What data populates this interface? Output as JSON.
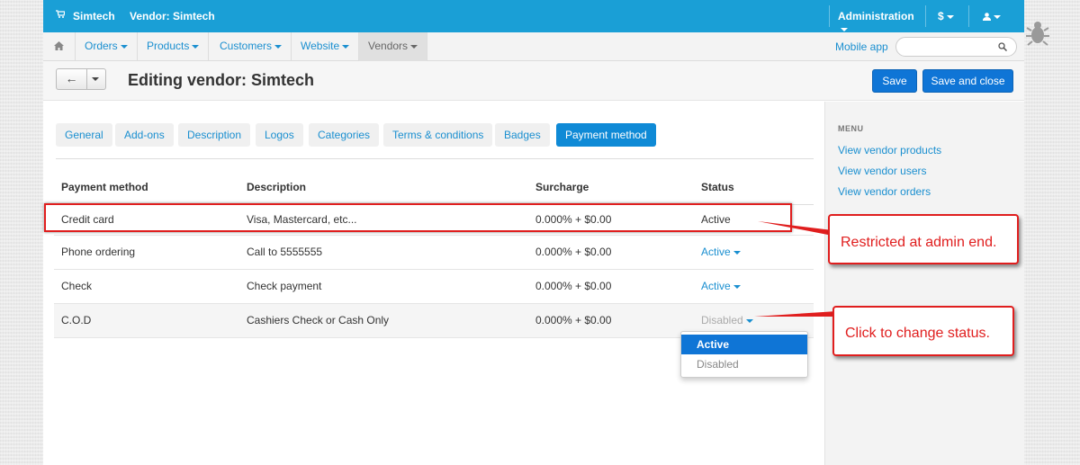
{
  "topbar": {
    "store_name": "Simtech",
    "vendor_label": "Vendor: Simtech",
    "admin_label": "Administration",
    "currency_label": "$"
  },
  "nav": {
    "items": [
      {
        "label": "Orders"
      },
      {
        "label": "Products"
      },
      {
        "label": "Customers"
      },
      {
        "label": "Website"
      },
      {
        "label": "Vendors"
      }
    ],
    "mobile_app": "Mobile app",
    "search_placeholder": ""
  },
  "titlebar": {
    "title": "Editing vendor: Simtech",
    "save": "Save",
    "save_and_close": "Save and close"
  },
  "tabs": [
    "General",
    "Add-ons",
    "Description",
    "Logos",
    "Categories",
    "Terms & conditions",
    "Badges",
    "Payment method"
  ],
  "table": {
    "headers": [
      "Payment method",
      "Description",
      "Surcharge",
      "Status"
    ],
    "rows": [
      {
        "method": "Credit card",
        "description": "Visa, Mastercard, etc...",
        "surcharge": "0.000% + $0.00",
        "status": "Active"
      },
      {
        "method": "Phone ordering",
        "description": "Call to 5555555",
        "surcharge": "0.000% + $0.00",
        "status": "Active"
      },
      {
        "method": "Check",
        "description": "Check payment",
        "surcharge": "0.000% + $0.00",
        "status": "Active"
      },
      {
        "method": "C.O.D",
        "description": "Cashiers Check or Cash Only",
        "surcharge": "0.000% + $0.00",
        "status": "Disabled"
      }
    ]
  },
  "status_dropdown": {
    "options": [
      "Active",
      "Disabled"
    ],
    "selected": "Active"
  },
  "sidebar": {
    "heading": "MENU",
    "links": [
      "View vendor products",
      "View vendor users",
      "View vendor orders"
    ]
  },
  "annotations": {
    "restricted": "Restricted at admin end.",
    "change_status": "Click to change status."
  },
  "colors": {
    "topbar": "#1a9fd6",
    "primary_button": "#0f75d6",
    "link": "#1a8fd0",
    "annotation": "#e01e1e"
  }
}
